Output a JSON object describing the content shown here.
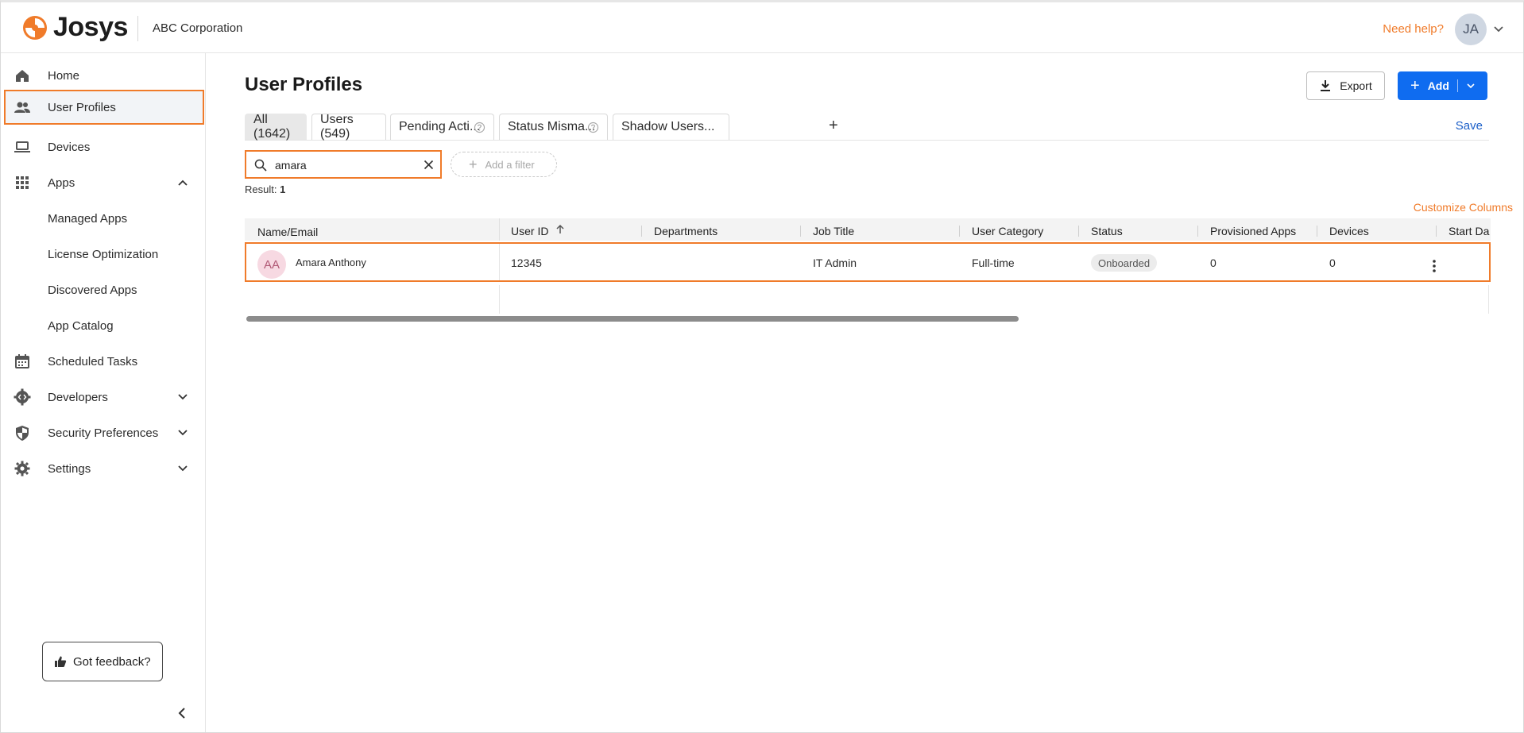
{
  "header": {
    "brand": "Josys",
    "organization": "ABC Corporation",
    "help_link": "Need help?",
    "user_initials": "JA",
    "brand_color": "#f07b2a"
  },
  "sidebar": {
    "items": [
      {
        "label": "Home",
        "icon": "home-icon"
      },
      {
        "label": "User Profiles",
        "icon": "users-icon",
        "active": true
      },
      {
        "label": "Devices",
        "icon": "laptop-icon"
      },
      {
        "label": "Apps",
        "icon": "grid-icon",
        "expanded": true
      },
      {
        "label": "Managed Apps"
      },
      {
        "label": "License Optimization"
      },
      {
        "label": "Discovered Apps"
      },
      {
        "label": "App Catalog"
      },
      {
        "label": "Scheduled Tasks",
        "icon": "calendar-icon"
      },
      {
        "label": "Developers",
        "icon": "code-gear-icon"
      },
      {
        "label": "Security Preferences",
        "icon": "shield-icon"
      },
      {
        "label": "Settings",
        "icon": "gear-icon"
      }
    ],
    "feedback_label": "Got feedback?"
  },
  "main": {
    "title": "User Profiles",
    "export_label": "Export",
    "add_label": "Add",
    "tabs": [
      {
        "label": "All (1642)",
        "active": true
      },
      {
        "label": "Users (549)"
      },
      {
        "label": "Pending Acti..."
      },
      {
        "label": "Status Misma..."
      },
      {
        "label": "Shadow Users..."
      }
    ],
    "add_tab_label": "+",
    "save_label": "Save",
    "search": {
      "value": "amara"
    },
    "add_filter_label": "Add a filter",
    "result_label": "Result:",
    "result_count": "1",
    "customize_columns_label": "Customize Columns",
    "table": {
      "columns": [
        "Name/Email",
        "User ID",
        "Departments",
        "Job Title",
        "User Category",
        "Status",
        "Provisioned Apps",
        "Devices",
        "Start Da"
      ],
      "rows": [
        {
          "initials": "AA",
          "name": "Amara Anthony",
          "user_id": "12345",
          "departments": "",
          "job_title": "IT Admin",
          "user_category": "Full-time",
          "status": "Onboarded",
          "provisioned_apps": "0",
          "devices": "0"
        }
      ]
    }
  }
}
